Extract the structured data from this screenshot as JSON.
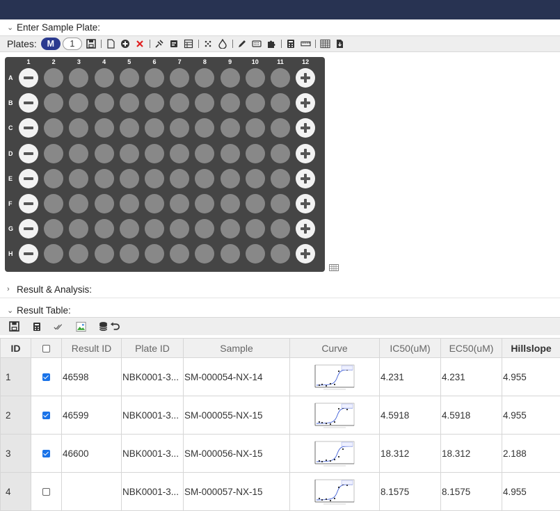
{
  "sections": {
    "plate_title": "Enter Sample Plate:",
    "analysis_title": "Result & Analysis:",
    "table_title": "Result Table:"
  },
  "plate_toolbar": {
    "label": "Plates:",
    "plates": [
      "M",
      "1"
    ],
    "active_plate": "M"
  },
  "plate": {
    "columns": [
      "1",
      "2",
      "3",
      "4",
      "5",
      "6",
      "7",
      "8",
      "9",
      "10",
      "11",
      "12"
    ],
    "rows": [
      "A",
      "B",
      "C",
      "D",
      "E",
      "F",
      "G",
      "H"
    ],
    "column1_control": "minus-icon",
    "column12_control": "plus-icon"
  },
  "result_table": {
    "headers": [
      "ID",
      "",
      "Result ID",
      "Plate ID",
      "Sample",
      "Curve",
      "IC50(uM)",
      "EC50(uM)",
      "Hillslope"
    ],
    "rows": [
      {
        "id": "1",
        "checked": true,
        "result_id": "46598",
        "plate_id": "NBK0001-3...",
        "sample": "SM-000054-NX-14",
        "ic50": "4.231",
        "ec50": "4.231",
        "hillslope": "4.955"
      },
      {
        "id": "2",
        "checked": true,
        "result_id": "46599",
        "plate_id": "NBK0001-3...",
        "sample": "SM-000055-NX-15",
        "ic50": "4.5918",
        "ec50": "4.5918",
        "hillslope": "4.955"
      },
      {
        "id": "3",
        "checked": true,
        "result_id": "46600",
        "plate_id": "NBK0001-3...",
        "sample": "SM-000056-NX-15",
        "ic50": "18.312",
        "ec50": "18.312",
        "hillslope": "2.188"
      },
      {
        "id": "4",
        "checked": false,
        "result_id": "",
        "plate_id": "NBK0001-3...",
        "sample": "SM-000057-NX-15",
        "ic50": "8.1575",
        "ec50": "8.1575",
        "hillslope": "4.955"
      }
    ]
  },
  "colors": {
    "topbar": "#283352",
    "plate_bg": "#454545",
    "well": "#888888",
    "active_pill": "#2b3a8f",
    "checkbox": "#1a73e8"
  }
}
